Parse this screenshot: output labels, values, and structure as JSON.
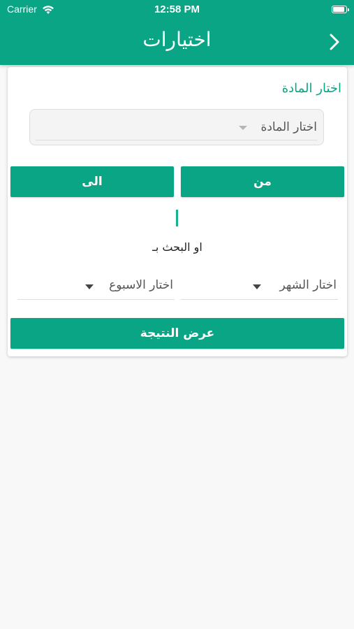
{
  "status_bar": {
    "carrier": "Carrier",
    "time": "12:58 PM"
  },
  "header": {
    "title": "اختيارات"
  },
  "subject": {
    "label": "اختار المادة",
    "dropdown_placeholder": "اختار المادة"
  },
  "range": {
    "from_label": "من",
    "to_label": "الى"
  },
  "search": {
    "or_search_by": "او البحث بـ",
    "month_placeholder": "اختار الشهر",
    "week_placeholder": "اختار الاسبوع"
  },
  "actions": {
    "show_result": "عرض النتيجة"
  },
  "colors": {
    "accent": "#0aa585",
    "background": "#f8f8f8"
  },
  "icons": {
    "back": "chevron-right-icon",
    "wifi": "wifi-icon",
    "battery": "battery-icon",
    "caret": "caret-down-icon"
  }
}
